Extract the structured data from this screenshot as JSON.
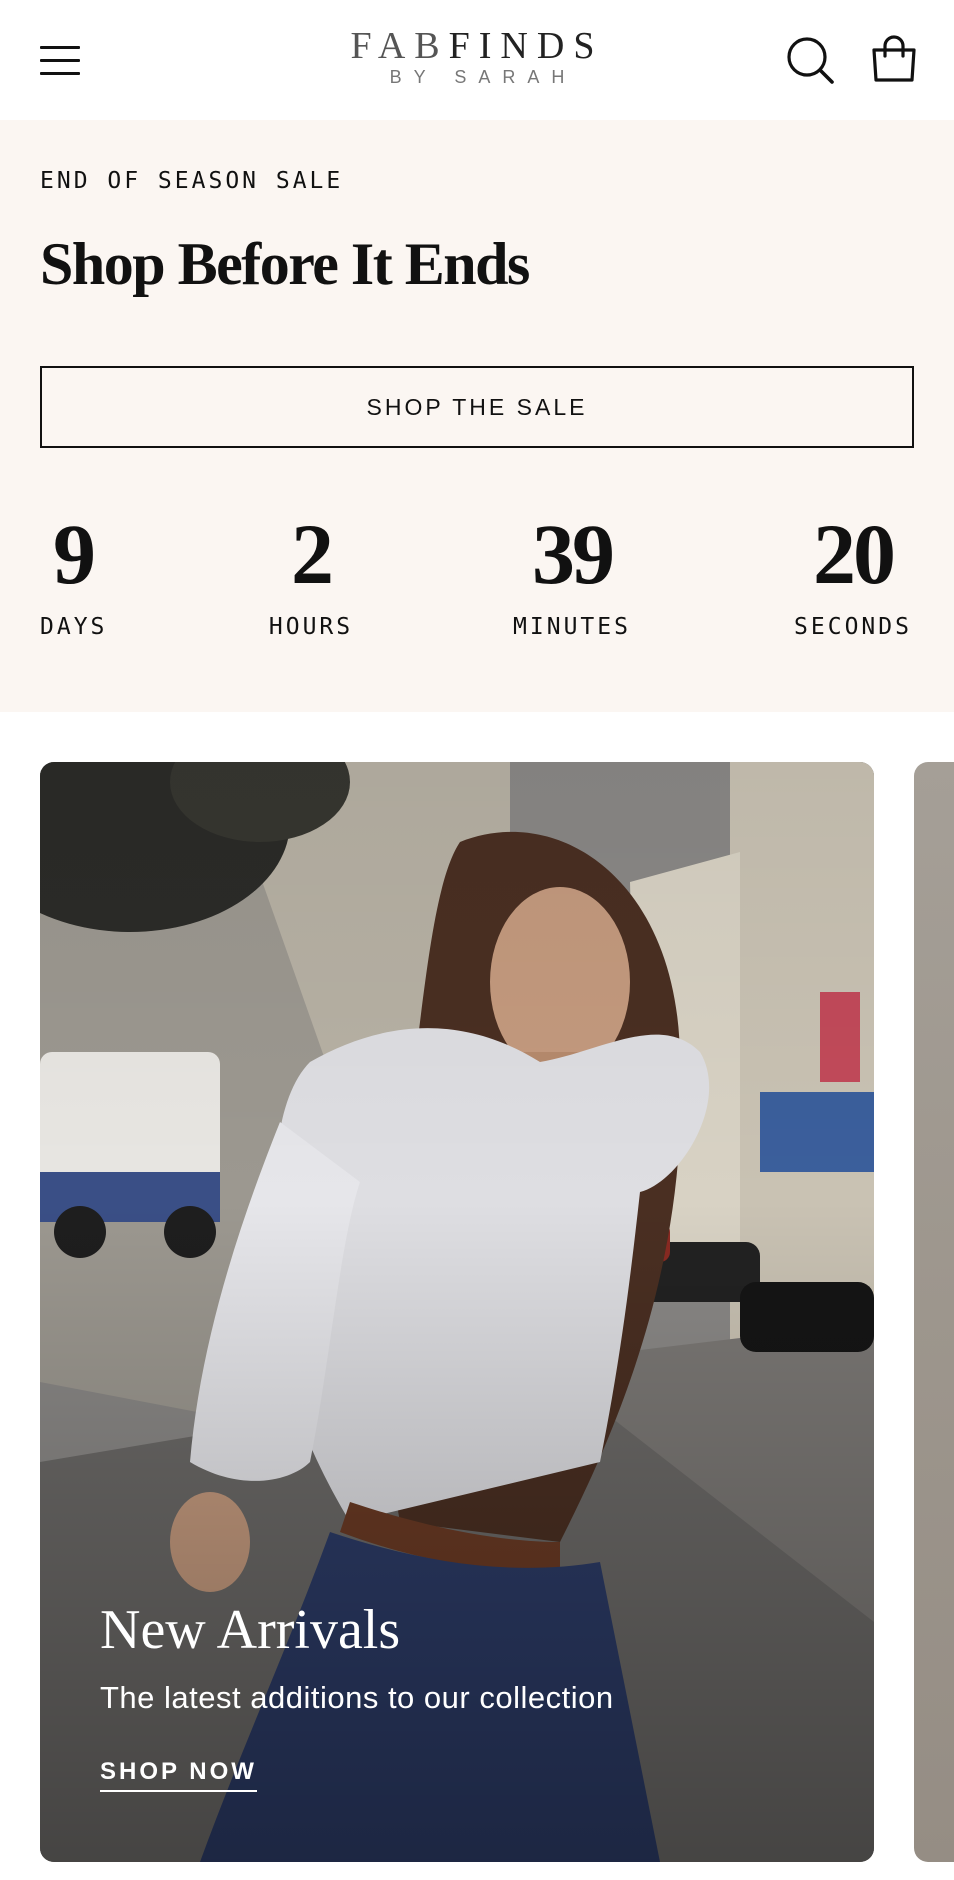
{
  "header": {
    "logo_main_a": "FAB",
    "logo_main_b": "FINDS",
    "logo_sub": "BY SARAH",
    "menu_icon": "hamburger-menu-icon",
    "search_icon": "search-icon",
    "cart_icon": "shopping-bag-icon"
  },
  "sale": {
    "eyebrow": "END OF SEASON SALE",
    "headline": "Shop Before It Ends",
    "button_label": "SHOP THE SALE",
    "background": "#fbf6f2",
    "countdown": [
      {
        "value": "9",
        "label": "DAYS"
      },
      {
        "value": "2",
        "label": "HOURS"
      },
      {
        "value": "39",
        "label": "MINUTES"
      },
      {
        "value": "20",
        "label": "SECONDS"
      }
    ]
  },
  "collections": [
    {
      "title": "New Arrivals",
      "subtitle": "The latest additions to our collection",
      "link_label": "SHOP NOW"
    }
  ]
}
